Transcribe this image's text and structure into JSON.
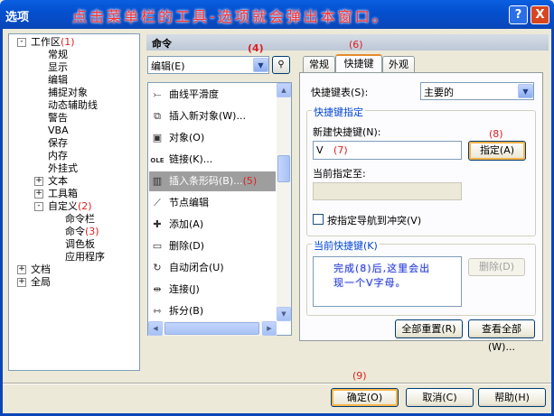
{
  "window": {
    "title": "选项",
    "annotation": "点击菜单栏的工具-选项就会弹出本窗口。",
    "help_glyph": "?",
    "close_glyph": "X"
  },
  "tree": {
    "items": [
      {
        "label": "工作区",
        "mark": "(1)",
        "expander": "-"
      },
      {
        "label": "常规"
      },
      {
        "label": "显示"
      },
      {
        "label": "编辑"
      },
      {
        "label": "捕捉对象"
      },
      {
        "label": "动态辅助线"
      },
      {
        "label": "警告"
      },
      {
        "label": "VBA"
      },
      {
        "label": "保存"
      },
      {
        "label": "内存"
      },
      {
        "label": "外挂式"
      },
      {
        "label": "文本",
        "expander": "+"
      },
      {
        "label": "工具箱",
        "expander": "+"
      },
      {
        "label": "自定义",
        "mark": "(2)",
        "expander": "-"
      },
      {
        "label": "命令栏"
      },
      {
        "label": "命令",
        "mark": "(3)"
      },
      {
        "label": "调色板"
      },
      {
        "label": "应用程序"
      },
      {
        "label": "文档",
        "expander": "+"
      },
      {
        "label": "全局",
        "expander": "+"
      }
    ]
  },
  "panel": {
    "header": "命令",
    "mark4": "(4)",
    "category_value": "编辑(E)",
    "binoculars_glyph": "⚲"
  },
  "commands": [
    {
      "icon": "⤚",
      "label": "曲线平滑度"
    },
    {
      "icon": "⧉",
      "label": "插入新对象(W)..."
    },
    {
      "icon": "▣",
      "label": "对象(O)"
    },
    {
      "icon": "OLE",
      "label": "链接(K)..."
    },
    {
      "icon": "▥",
      "label": "插入条形码(B)...",
      "mark": "(5)",
      "selected": true
    },
    {
      "icon": "⟋",
      "label": "节点编辑"
    },
    {
      "icon": "✚",
      "label": "添加(A)"
    },
    {
      "icon": "▭",
      "label": "删除(D)"
    },
    {
      "icon": "↻",
      "label": "自动闭合(U)"
    },
    {
      "icon": "⇹",
      "label": "连接(J)"
    },
    {
      "icon": "⇿",
      "label": "拆分(B)"
    }
  ],
  "scroll_glyphs": {
    "up": "▲",
    "down": "▼",
    "left": "◀",
    "right": "▶"
  },
  "tabs": {
    "mark6": "(6)",
    "items": [
      "常规",
      "快捷键",
      "外观"
    ],
    "active": 1
  },
  "shortcuts": {
    "table_label": "快捷键表(S):",
    "table_value": "主要的",
    "assign_group": "快捷键指定",
    "new_label": "新建快捷键(N):",
    "new_value": "V",
    "mark7": "(7)",
    "mark8": "(8)",
    "assign_button": "指定(A)",
    "current_label": "当前指定至:",
    "current_value": "",
    "conflict_label": "按指定导航到冲突(V)",
    "conflict_checked": false,
    "current_group": "当前快捷键(K)",
    "current_list_note": "完成(8)后,这里会出现一个V字母。",
    "delete_button": "删除(D)",
    "reset_all_button": "全部重置(R)",
    "view_all_button": "查看全部(W)..."
  },
  "footer": {
    "mark9": "(9)",
    "ok": "确定(O)",
    "cancel": "取消(C)",
    "help": "帮助(H)"
  }
}
